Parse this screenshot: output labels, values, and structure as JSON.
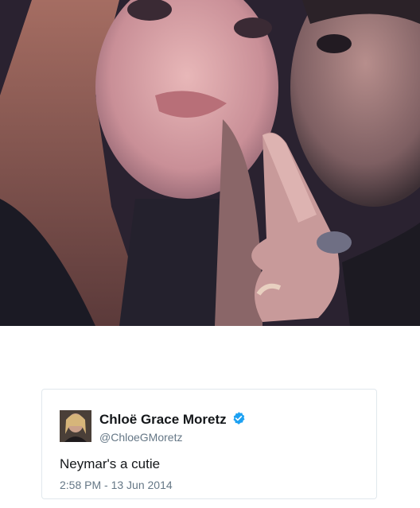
{
  "photo": {
    "description_icon": "selfie-photo"
  },
  "tweet": {
    "display_name": "Chloë Grace Moretz",
    "handle": "@ChloeGMoretz",
    "verified_icon": "verified-badge-icon",
    "text": "Neymar's a cutie",
    "timestamp": "2:58 PM - 13 Jun 2014"
  },
  "colors": {
    "verified": "#1da1f2",
    "name": "#14171a",
    "secondary": "#657786",
    "border": "#e1e8ed"
  }
}
